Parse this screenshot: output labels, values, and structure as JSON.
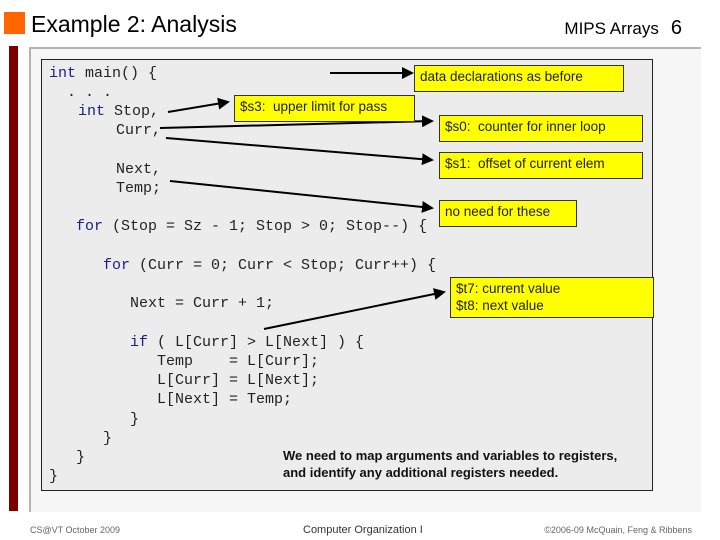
{
  "header": {
    "title": "Example 2: Analysis",
    "section": "MIPS Arrays",
    "page_number": "6"
  },
  "code": {
    "lines": [
      {
        "kw": "int",
        "text": " main() {"
      },
      {
        "kw": "",
        "text": ". . ."
      },
      {
        "kw": "int",
        "text": " Stop,"
      },
      {
        "kw": "",
        "text": "Curr,"
      },
      {
        "kw": "",
        "text": "Next,"
      },
      {
        "kw": "",
        "text": "Temp;"
      },
      {
        "kw": "for",
        "text": " (Stop = Sz - 1; Stop > 0; Stop--) {"
      },
      {
        "kw": "for",
        "text": " (Curr = 0; Curr < Stop; Curr++) {"
      },
      {
        "kw": "",
        "text": "Next = Curr + 1;"
      },
      {
        "kw": "if",
        "text": " ( L[Curr] > L[Next] ) {"
      },
      {
        "kw": "",
        "text": "Temp    = L[Curr];"
      },
      {
        "kw": "",
        "text": "L[Curr] = L[Next];"
      },
      {
        "kw": "",
        "text": "L[Next] = Temp;"
      },
      {
        "kw": "",
        "text": "}"
      },
      {
        "kw": "",
        "text": "}"
      },
      {
        "kw": "",
        "text": "}"
      },
      {
        "kw": "",
        "text": "}"
      }
    ]
  },
  "annotations": {
    "data_decl": "data declarations as before",
    "s3": "$s3:  upper limit for pass",
    "s0": "$s0:  counter for inner loop",
    "s1": "$s1:  offset of current elem",
    "no_need": "no need for these",
    "t7": "$t7:  current value",
    "t8": "$t8:  next value"
  },
  "summary_note": {
    "line1": "We need to map arguments and variables to registers,",
    "line2": "and identify any additional registers needed."
  },
  "footer": {
    "left": "CS@VT October 2009",
    "center": "Computer Organization I",
    "right": "©2006-09  McQuain, Feng & Ribbens"
  },
  "colors": {
    "accent_square": "#ff6600",
    "side_bar": "#7a0000",
    "note_bg": "#ffff00",
    "keyword": "#1a237e"
  }
}
